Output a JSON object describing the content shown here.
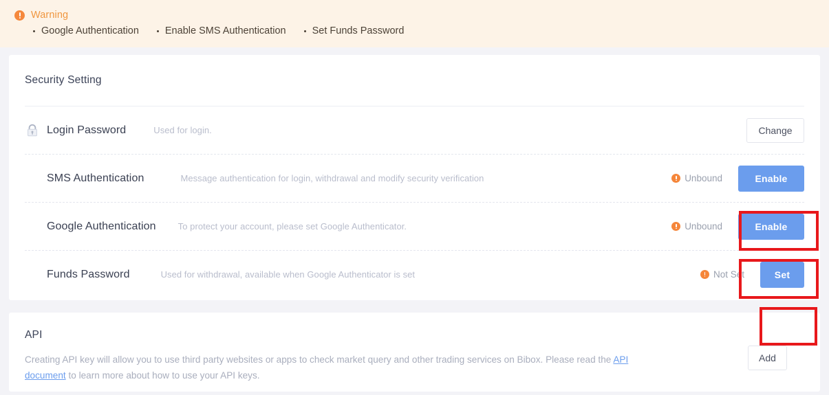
{
  "warning": {
    "icon": "alert-circle-icon",
    "title": "Warning",
    "items": [
      "Google Authentication",
      "Enable SMS Authentication",
      "Set Funds Password"
    ]
  },
  "security": {
    "title": "Security Setting",
    "rows": [
      {
        "icon": "lock-icon",
        "label": "Login Password",
        "desc": "Used for login.",
        "status": "",
        "action": "Change"
      },
      {
        "icon": "alert-circle-icon",
        "label": "SMS Authentication",
        "desc": "Message authentication for login, withdrawal and modify security verification",
        "status": "Unbound",
        "action": "Enable"
      },
      {
        "icon": "alert-circle-icon",
        "label": "Google Authentication",
        "desc": "To protect your account, please set Google Authenticator.",
        "status": "Unbound",
        "action": "Enable"
      },
      {
        "icon": "alert-circle-icon",
        "label": "Funds Password",
        "desc": "Used for withdrawal, available when Google Authenticator is set",
        "status": "Not Set",
        "action": "Set"
      }
    ]
  },
  "api": {
    "title": "API",
    "text_before": "Creating API key will allow you to use third party websites or apps to check market query and other trading services on Bibox. Please read the ",
    "link": "API document",
    "text_after": " to learn more about how to use your API keys.",
    "add_label": "Add"
  },
  "colors": {
    "accent_orange": "#F5863A",
    "primary_blue": "#6B9DED",
    "highlight_red": "#E8181B",
    "warning_bg": "#FDF3E7",
    "page_bg": "#F3F3F7"
  }
}
